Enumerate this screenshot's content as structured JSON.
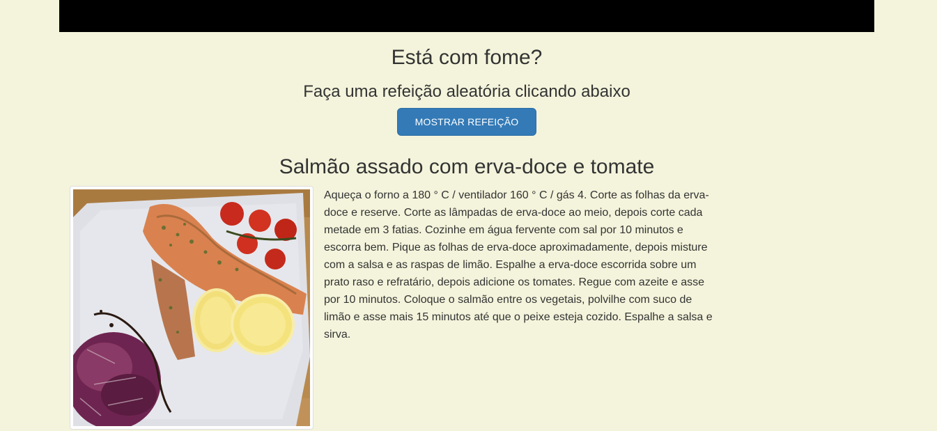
{
  "hero": {
    "title": "Está com fome?",
    "subtitle": "Faça uma refeição aleatória clicando abaixo",
    "button_label": "MOSTRAR REFEIÇÃO"
  },
  "meal": {
    "title": "Salmão assado com erva-doce e tomate",
    "image_icon": "salmon-dish-photo",
    "instructions": "Aqueça o forno a 180 ° C / ventilador 160 ° C / gás 4. Corte as folhas da erva-doce e reserve. Corte as lâmpadas de erva-doce ao meio, depois corte cada metade em 3 fatias. Cozinhe em água fervente com sal por 10 minutos e escorra bem. Pique as folhas de erva-doce aproximadamente, depois misture com a salsa e as raspas de limão. Espalhe a erva-doce escorrida sobre um prato raso e refratário, depois adicione os tomates. Regue com azeite e asse por 10 minutos. Coloque o salmão entre os vegetais, polvilhe com suco de limão e asse mais 15 minutos até que o peixe esteja cozido. Espalhe a salsa e sirva."
  },
  "colors": {
    "background": "#f4f4dc",
    "topbar": "#000000",
    "button": "#337ab7",
    "text": "#333333"
  }
}
